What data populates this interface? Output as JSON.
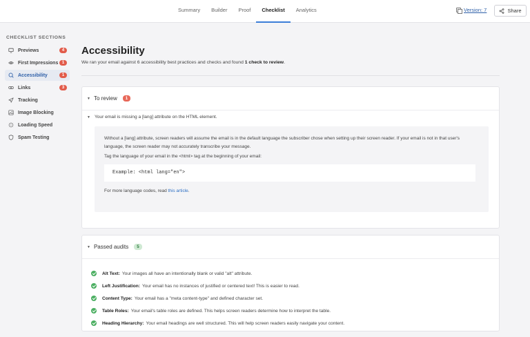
{
  "nav": {
    "tabs": [
      {
        "label": "Summary"
      },
      {
        "label": "Builder"
      },
      {
        "label": "Proof"
      },
      {
        "label": "Checklist"
      },
      {
        "label": "Analytics"
      }
    ],
    "active_tab": "Checklist",
    "version_label": "Version: 7",
    "share_label": "Share"
  },
  "sidebar": {
    "title": "CHECKLIST SECTIONS",
    "items": [
      {
        "label": "Previews",
        "badge": "4",
        "icon": "monitor-icon"
      },
      {
        "label": "First Impressions",
        "badge": "1",
        "icon": "eye-icon"
      },
      {
        "label": "Accessibility",
        "badge": "1",
        "icon": "accessibility-icon"
      },
      {
        "label": "Links",
        "badge": "3",
        "icon": "link-icon"
      },
      {
        "label": "Tracking",
        "badge": "",
        "icon": "send-icon"
      },
      {
        "label": "Image Blocking",
        "badge": "",
        "icon": "image-icon"
      },
      {
        "label": "Loading Speed",
        "badge": "",
        "icon": "loader-icon"
      },
      {
        "label": "Spam Testing",
        "badge": "",
        "icon": "shield-icon"
      }
    ],
    "active_item": "Accessibility"
  },
  "main": {
    "title": "Accessibility",
    "subtitle_pre": "We ran your email against 6 accessibility best practices and checks and found ",
    "subtitle_bold": "1 check to review",
    "subtitle_post": ".",
    "review": {
      "title": "To review",
      "count": "1",
      "issue_title": "Your email is missing a [lang] attribute on the HTML element.",
      "issue_text": "Without a [lang] attribute, screen readers will assume the email is in the default language the subscriber chose when setting up their screen reader. If your email is not in that user's language, the screen reader may not accurately transcribe your message.",
      "issue_tag_text": "Tag the language of your email in the <html> tag at the beginning of your email:",
      "code_example": "Example: <html lang=\"en\">",
      "more_pre": "For more language codes, read ",
      "more_link": "this article",
      "more_post": "."
    },
    "passed": {
      "title": "Passed audits",
      "count": "5",
      "items": [
        {
          "name": "Alt Text:",
          "text": "Your images all have an intentionally blank or valid \"alt\" attribute."
        },
        {
          "name": "Left Justification:",
          "text": "Your email has no instances of justified or centered text! This is easier to read."
        },
        {
          "name": "Content Type:",
          "text": "Your email has a \"meta content-type\" and defined character set."
        },
        {
          "name": "Table Roles:",
          "text": "Your email's table roles are defined. This helps screen readers determine how to interpret the table."
        },
        {
          "name": "Heading Hierarchy:",
          "text": "Your email headings are well structured. This will help screen readers easily navigate your content."
        }
      ]
    }
  },
  "colors": {
    "accent": "#3b7dd8",
    "badge_red": "#e25c4b",
    "pass_green": "#4caf62"
  }
}
